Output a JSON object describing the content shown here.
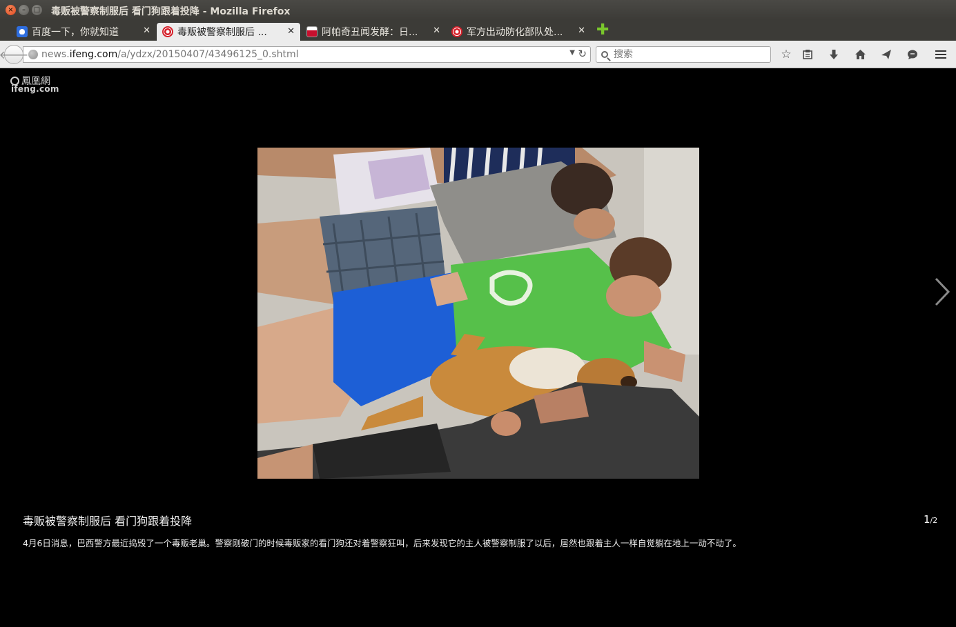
{
  "window": {
    "title": "毒贩被警察制服后 看门狗跟着投降 - Mozilla Firefox"
  },
  "tabs": [
    {
      "label": "百度一下，你就知道",
      "favicon": "baidu-paw-icon",
      "active": false
    },
    {
      "label": "毒贩被警察制服后 ...",
      "favicon": "ifeng-swirl-icon",
      "active": true
    },
    {
      "label": "阿帕奇丑闻发酵：日...",
      "favicon": "flag-icon",
      "active": false
    },
    {
      "label": "军方出动防化部队处...",
      "favicon": "ifeng-swirl-icon",
      "active": false
    }
  ],
  "nav": {
    "url_prefix": "news.",
    "url_domain": "ifeng.com",
    "url_path": "/a/ydzx/20150407/43496125_0.shtml",
    "search_placeholder": "搜索"
  },
  "page": {
    "logo_cn": "鳳凰網",
    "logo_en": "ifeng.com",
    "caption_title": "毒贩被警察制服后 看门狗跟着投降",
    "pager_current": "1",
    "pager_total": "/2",
    "caption_body": "4月6日消息，巴西警方最近捣毁了一个毒贩老巢。警察刚破门的时候毒贩家的看门狗还对着警察狂叫，后来发现它的主人被警察制服了以后，居然也跟着主人一样自觉躺在地上一动不动了。"
  }
}
